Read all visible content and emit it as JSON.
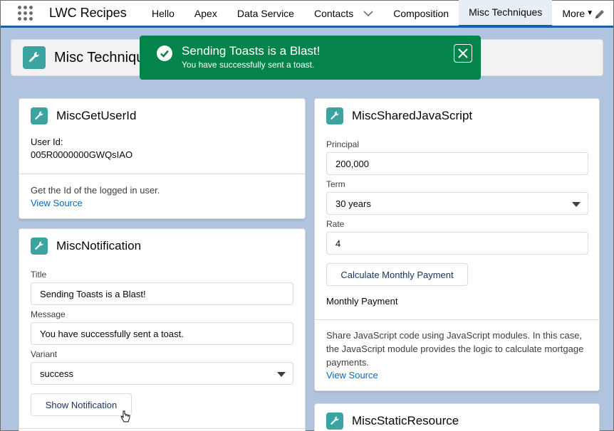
{
  "app": {
    "name": "LWC Recipes"
  },
  "nav": {
    "tabs": [
      "Hello",
      "Apex",
      "Data Service",
      "Contacts",
      "Composition",
      "Misc Techniques",
      "More"
    ],
    "active": "Misc Techniques"
  },
  "header": {
    "title": "Misc Techniques"
  },
  "toast": {
    "title": "Sending Toasts is a Blast!",
    "message": "You have successfully sent a toast.",
    "color": "#04844b"
  },
  "user_id_card": {
    "title": "MiscGetUserId",
    "label": "User Id:",
    "value": "005R0000000GWQsIAO",
    "description": "Get the Id of the logged in user.",
    "link": "View Source"
  },
  "notification_card": {
    "title": "MiscNotification",
    "title_label": "Title",
    "title_value": "Sending Toasts is a Blast!",
    "message_label": "Message",
    "message_value": "You have successfully sent a toast.",
    "variant_label": "Variant",
    "variant_value": "success",
    "button": "Show Notification"
  },
  "shared_js_card": {
    "title": "MiscSharedJavaScript",
    "principal_label": "Principal",
    "principal_value": "200,000",
    "term_label": "Term",
    "term_value": "30 years",
    "rate_label": "Rate",
    "rate_value": "4",
    "button": "Calculate Monthly Payment",
    "result_label": "Monthly Payment",
    "description": "Share JavaScript code using JavaScript modules. In this case, the JavaScript module provides the logic to calculate mortgage payments.",
    "link": "View Source"
  },
  "static_resource_card": {
    "title": "MiscStaticResource"
  },
  "colors": {
    "accent": "#0070d2",
    "brand_bar": "#1b5fa8",
    "icon_bg": "#3ba4a0"
  }
}
